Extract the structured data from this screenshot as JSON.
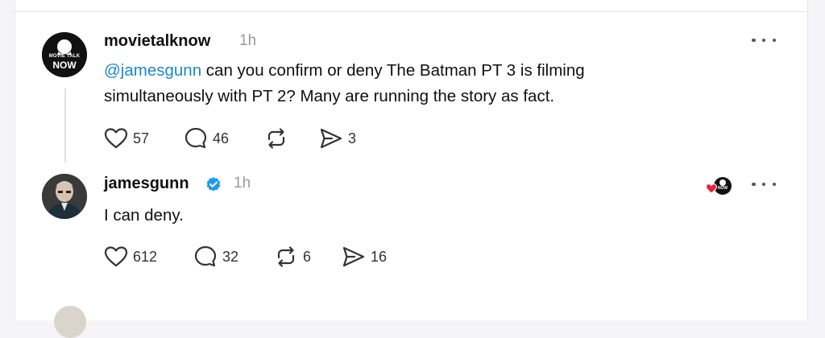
{
  "posts": [
    {
      "username": "movietalknow",
      "time": "1h",
      "avatar_text_top": "MOVIE TALK",
      "avatar_text_bottom": "NOW",
      "mention": "@jamesgunn",
      "text_line1": " can you confirm or deny The Batman PT 3 is filming",
      "text_line2": "simultaneously with PT 2? Many are running the story as fact.",
      "actions": {
        "likes": "57",
        "replies": "46",
        "reposts": "",
        "shares": "3"
      },
      "icons": [
        "heart-icon",
        "comment-icon",
        "repost-icon",
        "share-icon",
        "more-icon"
      ]
    },
    {
      "username": "jamesgunn",
      "time": "1h",
      "verified": true,
      "text": "I can deny.",
      "liked_by_badge_text": "NOW",
      "actions": {
        "likes": "612",
        "replies": "32",
        "reposts": "6",
        "shares": "16"
      },
      "icons": [
        "heart-icon",
        "comment-icon",
        "repost-icon",
        "share-icon",
        "more-icon",
        "verified-badge-icon"
      ]
    }
  ],
  "colors": {
    "mention": "#1b88d4",
    "verified": "#1d9bf0",
    "liked_heart": "#e8243b",
    "background": "#f5f5f7",
    "card": "#ffffff"
  }
}
